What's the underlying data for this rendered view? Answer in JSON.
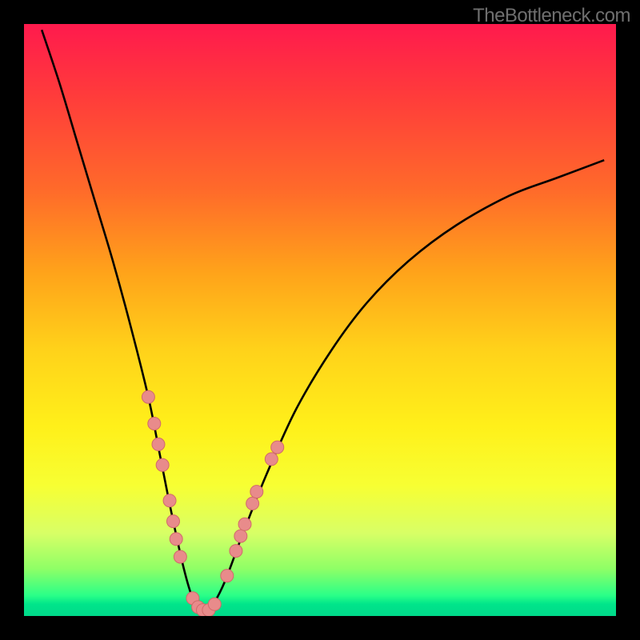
{
  "watermark": "TheBottleneck.com",
  "colors": {
    "frame": "#000000",
    "curve": "#000000",
    "marker_fill": "#e88b8b",
    "marker_stroke": "#d16a6a"
  },
  "chart_data": {
    "type": "line",
    "title": "",
    "xlabel": "",
    "ylabel": "",
    "xlim": [
      0,
      100
    ],
    "ylim": [
      0,
      100
    ],
    "series": [
      {
        "name": "bottleneck-curve",
        "x": [
          3,
          6,
          9,
          12,
          15,
          18,
          21,
          23,
          25,
          27,
          28.5,
          30,
          31,
          32,
          34,
          37,
          41,
          46,
          52,
          58,
          65,
          73,
          82,
          90,
          98
        ],
        "y": [
          99,
          90,
          80,
          70,
          60,
          49,
          37,
          27,
          17,
          8,
          3,
          1,
          1,
          2,
          6,
          14,
          24,
          35,
          45,
          53,
          60,
          66,
          71,
          74,
          77
        ]
      }
    ],
    "markers": [
      {
        "x": 21.0,
        "y": 37.0
      },
      {
        "x": 22.0,
        "y": 32.5
      },
      {
        "x": 22.7,
        "y": 29.0
      },
      {
        "x": 23.4,
        "y": 25.5
      },
      {
        "x": 24.6,
        "y": 19.5
      },
      {
        "x": 25.2,
        "y": 16.0
      },
      {
        "x": 25.7,
        "y": 13.0
      },
      {
        "x": 26.4,
        "y": 10.0
      },
      {
        "x": 28.5,
        "y": 3.0
      },
      {
        "x": 29.4,
        "y": 1.5
      },
      {
        "x": 30.2,
        "y": 1.0
      },
      {
        "x": 31.2,
        "y": 1.0
      },
      {
        "x": 32.2,
        "y": 2.0
      },
      {
        "x": 34.3,
        "y": 6.8
      },
      {
        "x": 35.8,
        "y": 11.0
      },
      {
        "x": 36.6,
        "y": 13.5
      },
      {
        "x": 37.3,
        "y": 15.5
      },
      {
        "x": 38.6,
        "y": 19.0
      },
      {
        "x": 39.3,
        "y": 21.0
      },
      {
        "x": 41.8,
        "y": 26.5
      },
      {
        "x": 42.8,
        "y": 28.5
      }
    ]
  }
}
